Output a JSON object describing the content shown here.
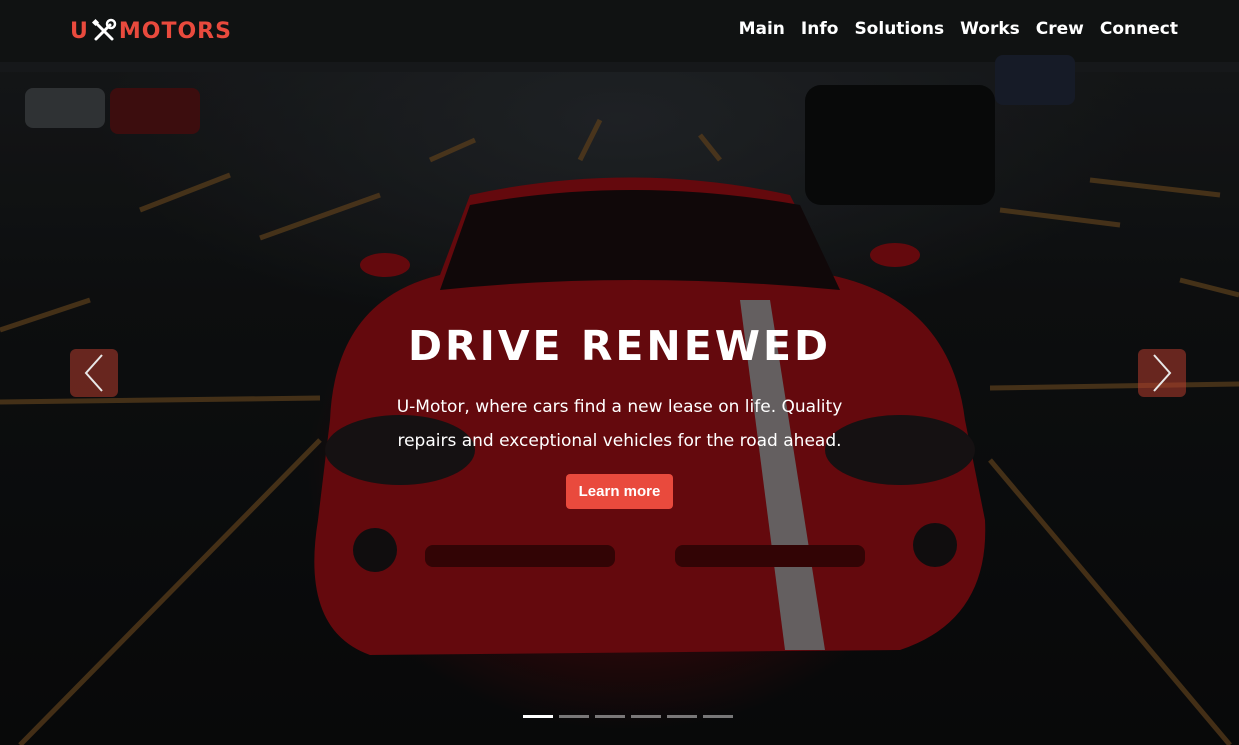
{
  "brand": {
    "name_prefix": "U",
    "name_suffix": "MOTORS",
    "icon": "wrench-screwdriver-icon",
    "accent_color": "#e94a3d"
  },
  "nav": {
    "items": [
      {
        "label": "Main"
      },
      {
        "label": "Info"
      },
      {
        "label": "Solutions"
      },
      {
        "label": "Works"
      },
      {
        "label": "Crew"
      },
      {
        "label": "Connect"
      }
    ]
  },
  "hero": {
    "title": "DRIVE RENEWED",
    "subtitle": "U-Motor, where cars find a new lease on life. Quality repairs and exceptional vehicles for the road ahead.",
    "cta_label": "Learn more",
    "prev_icon": "chevron-left-icon",
    "next_icon": "chevron-right-icon",
    "slide_count": 6,
    "active_slide": 1
  }
}
